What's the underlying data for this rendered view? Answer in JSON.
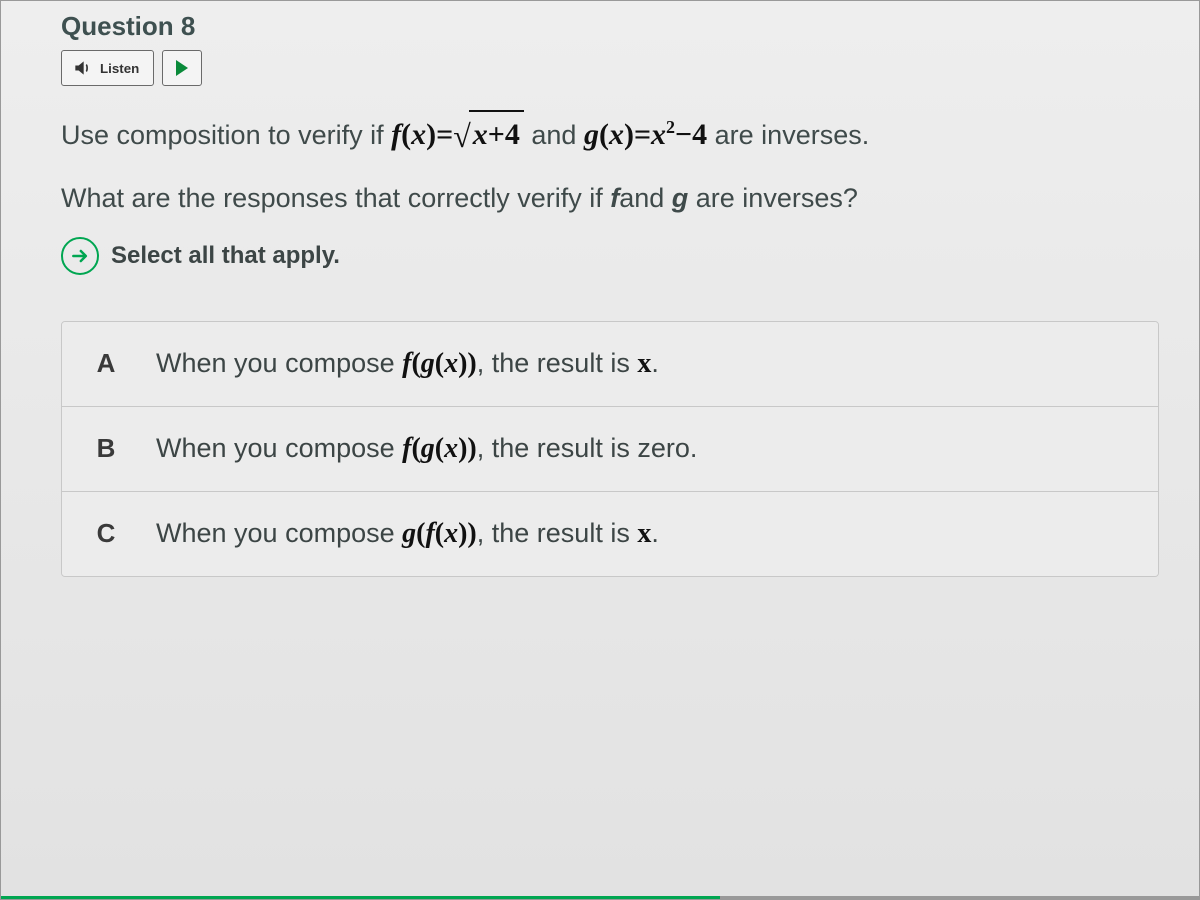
{
  "question": {
    "title": "Question 8",
    "listen_label": "Listen",
    "prompt_part1": "Use composition to verify if ",
    "prompt_and": " and ",
    "prompt_part2": " are inverses.",
    "f_label": "f(x)=√(x+4)",
    "g_label": "g(x)=x²−4",
    "prompt_line2_a": "What are the responses that correctly verify if ",
    "prompt_line2_f": "f",
    "prompt_line2_mid": "and ",
    "prompt_line2_g": "g",
    "prompt_line2_b": " are inverses?",
    "instruction": "Select all that apply."
  },
  "options": [
    {
      "letter": "A",
      "pre": "When you compose ",
      "expr_plain": "f(g(x))",
      "post": ", the result is ",
      "tail": "x",
      "period": "."
    },
    {
      "letter": "B",
      "pre": "When you compose ",
      "expr_plain": "f(g(x))",
      "post": ", the result is zero.",
      "tail": "",
      "period": ""
    },
    {
      "letter": "C",
      "pre": "When you compose ",
      "expr_plain": "g(f(x))",
      "post": ", the result is ",
      "tail": "x",
      "period": "."
    }
  ]
}
